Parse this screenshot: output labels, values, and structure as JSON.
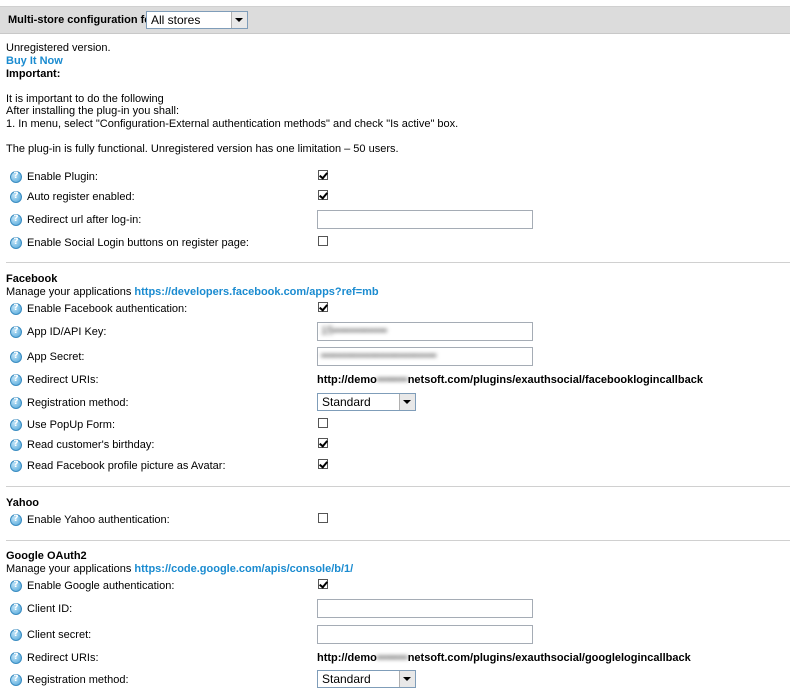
{
  "header": {
    "label": "Multi-store configuration for",
    "store_value": "All stores"
  },
  "intro": {
    "unregistered": "Unregistered version.",
    "buy_now": "Buy It Now",
    "important": "Important:",
    "line1": "It is important to do the following",
    "line2": "After installing the plug-in you shall:",
    "line3": "1. In menu, select \"Configuration-External authentication methods\" and check \"Is active\" box.",
    "functional": "The plug-in is fully functional. Unregistered version has one limitation – 50 users."
  },
  "general": {
    "enable_plugin": {
      "label": "Enable Plugin:",
      "checked": true
    },
    "auto_register": {
      "label": "Auto register enabled:",
      "checked": true
    },
    "redirect_url": {
      "label": "Redirect url after log-in:",
      "value": ""
    },
    "social_buttons": {
      "label": "Enable Social Login buttons on register page:",
      "checked": false
    }
  },
  "facebook": {
    "title": "Facebook",
    "manage_text": "Manage your applications",
    "manage_link": "https://developers.facebook.com/apps?ref=mb",
    "enable": {
      "label": "Enable Facebook authentication:",
      "checked": true
    },
    "app_id": {
      "label": "App ID/API Key:",
      "value": "15••••••••••••••"
    },
    "app_secret": {
      "label": "App Secret:",
      "value": "••••••••••••••••••••••••••••••"
    },
    "redirect": {
      "label": "Redirect URIs:",
      "prefix": "http://demo",
      "hidden": "••••••••",
      "suffix": "netsoft.com/plugins/exauthsocial/facebooklogincallback"
    },
    "registration": {
      "label": "Registration method:",
      "value": "Standard"
    },
    "popup": {
      "label": "Use PopUp Form:",
      "checked": false
    },
    "birthday": {
      "label": "Read customer's birthday:",
      "checked": true
    },
    "avatar": {
      "label": "Read Facebook profile picture as Avatar:",
      "checked": true
    }
  },
  "yahoo": {
    "title": "Yahoo",
    "enable": {
      "label": "Enable Yahoo authentication:",
      "checked": false
    }
  },
  "google": {
    "title": "Google OAuth2",
    "manage_text": "Manage your applications",
    "manage_link": "https://code.google.com/apis/console/b/1/",
    "enable": {
      "label": "Enable Google authentication:",
      "checked": true
    },
    "client_id": {
      "label": "Client ID:",
      "value": ""
    },
    "client_secret": {
      "label": "Client secret:",
      "value": ""
    },
    "redirect": {
      "label": "Redirect URIs:",
      "prefix": "http://demo",
      "hidden": "••••••••",
      "suffix": "netsoft.com/plugins/exauthsocial/googlelogincallback"
    },
    "registration": {
      "label": "Registration method:",
      "value": "Standard"
    }
  }
}
